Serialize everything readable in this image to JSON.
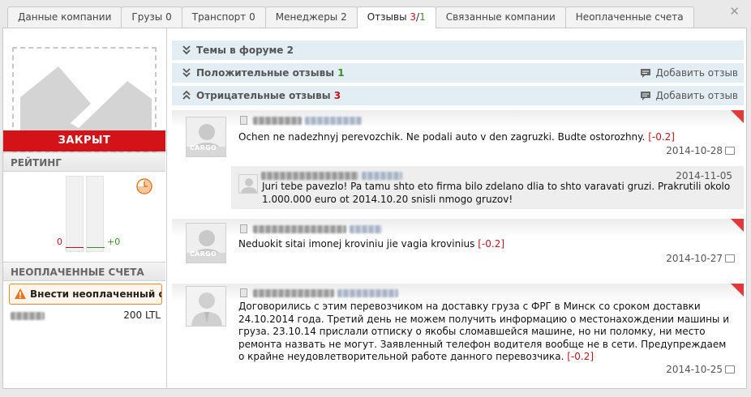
{
  "tabs": [
    {
      "label": "Данные компании",
      "active": false
    },
    {
      "label": "Грузы 0",
      "active": false
    },
    {
      "label": "Транспорт 0",
      "active": false
    },
    {
      "label": "Менеджеры 2",
      "active": false
    },
    {
      "label": "Отзывы ",
      "count_neg": "3",
      "sep": "/",
      "count_pos": "1",
      "active": true
    },
    {
      "label": "Связанные компании",
      "active": false
    },
    {
      "label": "Неоплаченные счета",
      "active": false
    }
  ],
  "close_label": "✕",
  "sidebar": {
    "status": "ЗАКРЫТ",
    "rating_title": "РЕЙТИНГ",
    "rating_negative": "0",
    "rating_positive": "+0",
    "unpaid_title": "НЕОПЛАЧЕННЫЕ СЧЕТА",
    "add_unpaid_label": "Внести неоплаченный счёт",
    "debt_amount": "200 LTL"
  },
  "sections": [
    {
      "label": "Темы в форуме ",
      "count": "2",
      "expanded": false
    },
    {
      "label": "Положительные отзывы ",
      "count": "1",
      "expanded": false,
      "add_label": "Добавить отзыв"
    },
    {
      "label": "Отрицательные отзывы ",
      "count": "3",
      "expanded": true,
      "add_label": "Добавить отзыв"
    }
  ],
  "reviews": [
    {
      "text": "Ochen ne nadezhnyj perevozchik. Ne podali auto v den zagruzki. Budte ostorozhny. ",
      "score": "[-0.2]",
      "date": "2014-10-28",
      "avatar_tag": "CARGO",
      "reply": {
        "date": "2014-11-05",
        "text": "Juri tebe pavezlo! Pa tamu shto eto firma bilo zdelano dlia to shto varavati gruzi. Prakrutili okolo 1.000.000 euro ot 2014.10.20 snisli nmogo gruzov!"
      }
    },
    {
      "text": "Neduokit sitai imonej kroviniu jie vagia krovinius ",
      "score": "[-0.2]",
      "date": "2014-10-27",
      "avatar_tag": "CARGO"
    },
    {
      "text": "Договорились с этим перевозчиком на доставку груза с ФРГ в Минск со сроком доставки 24.10.2014 года. Третий день не можем получить информацию о местонахождении машины и груза. 23.10.14 прислали отписку о якобы сломавшейся машине, но ни поломку, ни место ремонта назвать не могут. Заявленный телефон водителя вообще не в сети. Предупреждаем о крайне неудовлетворительной работе данного перевозчика. ",
      "score": "[-0.2]",
      "date": "2014-10-25"
    }
  ],
  "colors": {
    "red": "#d31317",
    "green": "#3d8d2b",
    "accent_bg": "#e3edf4",
    "warn": "#e58a2e"
  }
}
